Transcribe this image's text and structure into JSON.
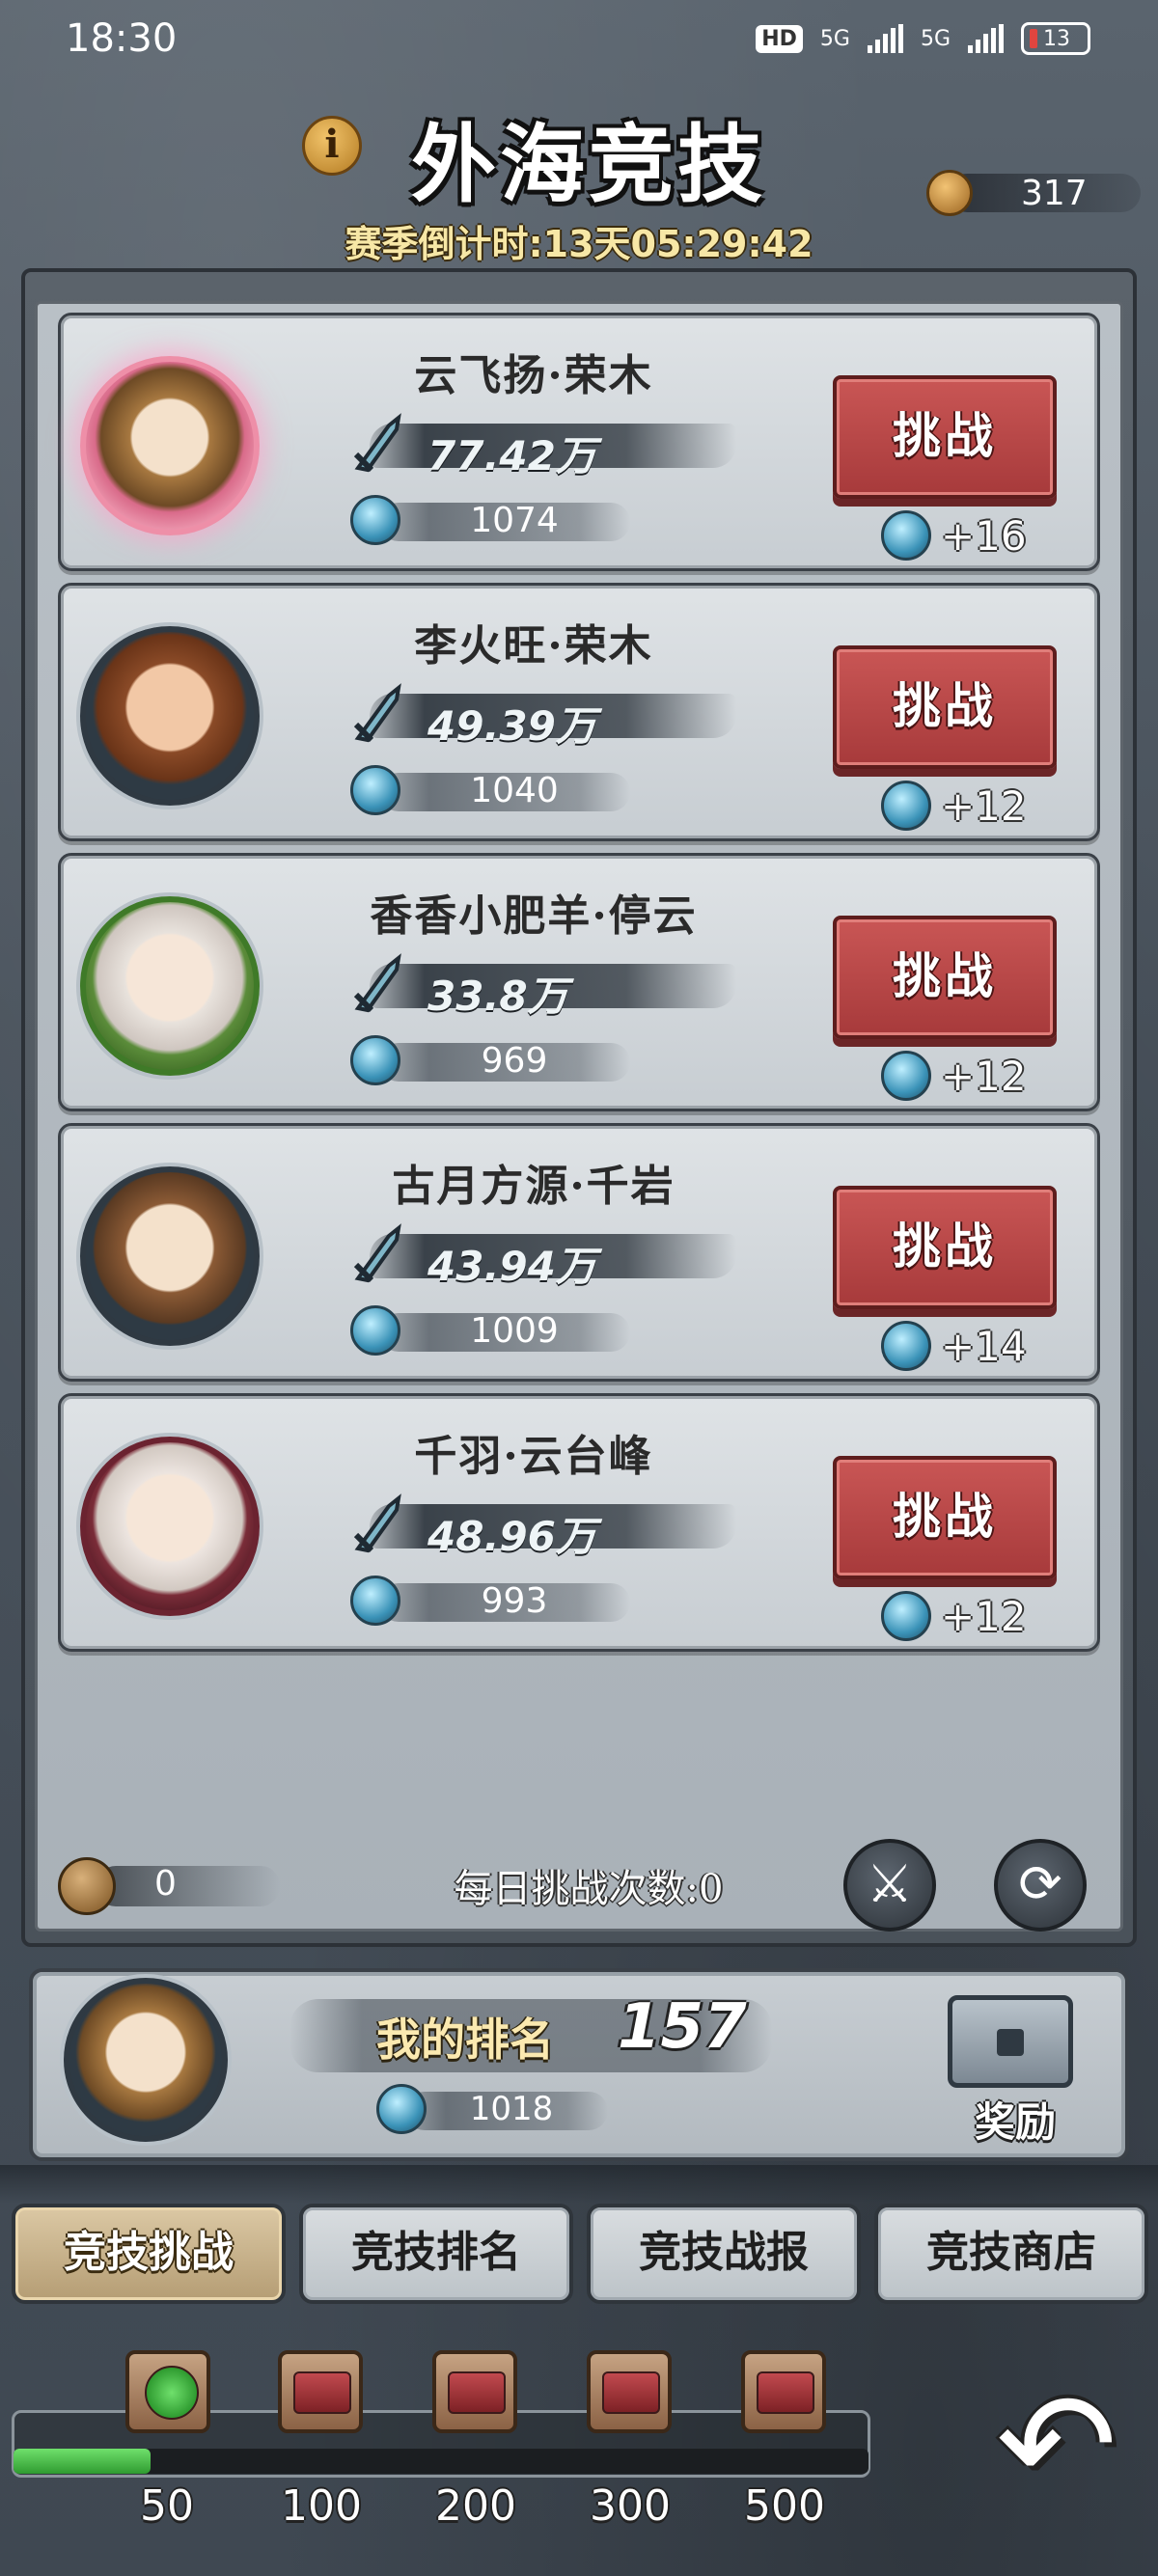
{
  "status_bar": {
    "time": "18:30",
    "hd_badge": "HD",
    "net1": "5G",
    "net2": "5G",
    "battery": "13"
  },
  "header": {
    "info_icon_glyph": "i",
    "title": "外海竞技",
    "countdown": "赛季倒计时:13天05:29:42",
    "currency_value": "317"
  },
  "opponents": [
    {
      "name": "云飞扬·荣木",
      "power": "77.42万",
      "score": "1074",
      "button": "挑战",
      "reward": "+16"
    },
    {
      "name": "李火旺·荣木",
      "power": "49.39万",
      "score": "1040",
      "button": "挑战",
      "reward": "+12"
    },
    {
      "name": "香香小肥羊·停云",
      "power": "33.8万",
      "score": "969",
      "button": "挑战",
      "reward": "+12"
    },
    {
      "name": "古月方源·千岩",
      "power": "43.94万",
      "score": "1009",
      "button": "挑战",
      "reward": "+14"
    },
    {
      "name": "千羽·云台峰",
      "power": "48.96万",
      "score": "993",
      "button": "挑战",
      "reward": "+12"
    }
  ],
  "daily": {
    "token_count": "0",
    "label": "每日挑战次数:0",
    "formation_glyph": "⚔",
    "refresh_glyph": "⟳"
  },
  "my_rank": {
    "label": "我的排名",
    "rank": "157",
    "score": "1018",
    "reward_label": "奖励"
  },
  "tabs": [
    {
      "label": "竞技挑战",
      "active": true
    },
    {
      "label": "竞技排名",
      "active": false
    },
    {
      "label": "竞技战报",
      "active": false
    },
    {
      "label": "竞技商店",
      "active": false
    }
  ],
  "progress": {
    "fraction": 0.16,
    "milestones": [
      "50",
      "100",
      "200",
      "300",
      "500"
    ],
    "claimed": [
      true,
      false,
      false,
      false,
      false
    ]
  },
  "back_glyph": "↶"
}
